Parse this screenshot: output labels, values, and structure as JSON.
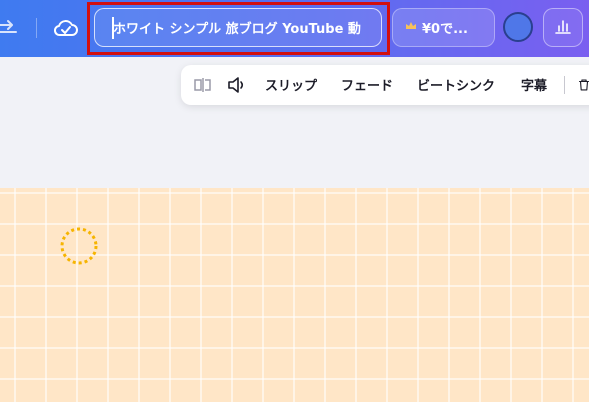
{
  "topbar": {
    "project_title": "ホワイト シンプル 旅ブログ YouTube 動",
    "price_label": "¥0で...",
    "icons": {
      "redo": "redo-icon",
      "cloud": "cloud-check-icon",
      "crown": "crown-icon",
      "stats": "bar-chart-icon"
    },
    "colors": {
      "gradient_start": "#3f7bf0",
      "gradient_end": "#7a5ff0",
      "highlight": "#d20f0f"
    }
  },
  "toolbar": {
    "items": [
      {
        "label": "スリップ"
      },
      {
        "label": "フェード"
      },
      {
        "label": "ビートシンク"
      },
      {
        "label": "字幕"
      }
    ],
    "icons": {
      "split": "split-icon",
      "volume": "volume-icon",
      "delete": "trash-icon"
    }
  },
  "canvas": {
    "background_color": "#ffe6c7",
    "marker_color": "#f6b400"
  }
}
